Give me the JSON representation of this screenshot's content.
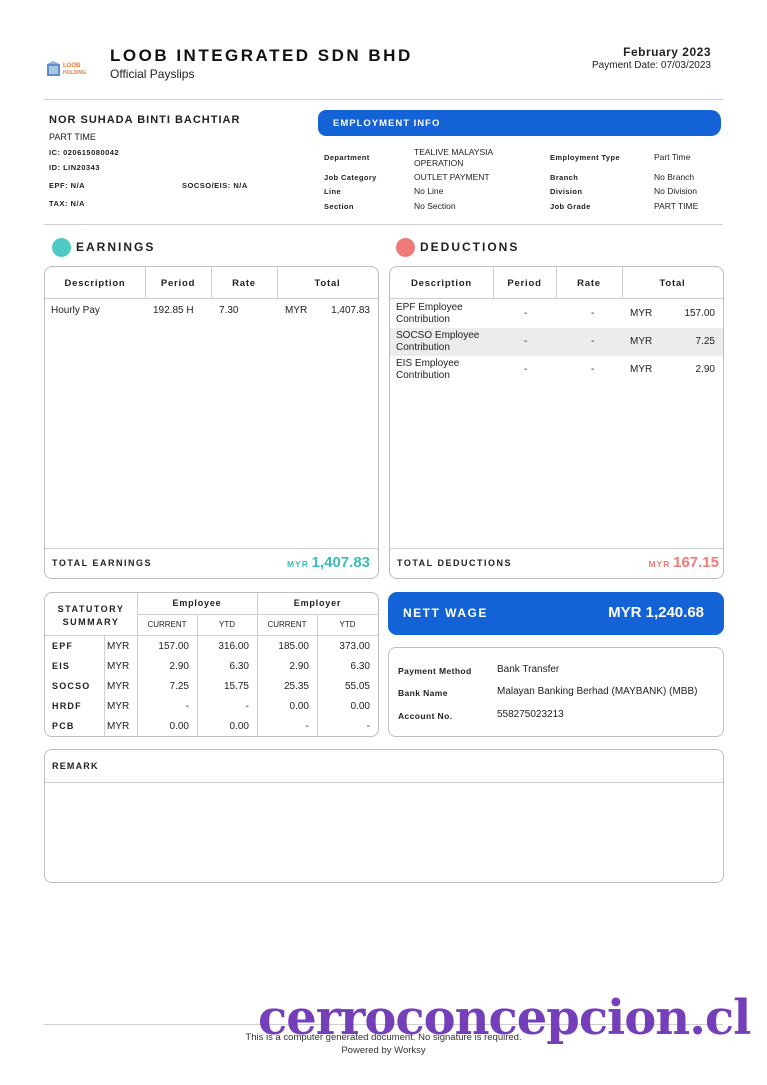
{
  "header": {
    "company_name": "LOOB INTEGRATED SDN BHD",
    "document_title": "Official Payslips",
    "period": "February 2023",
    "payment_date": "Payment Date: 07/03/2023",
    "logo_text_top": "LOOB",
    "logo_text_bottom": "HOLDING"
  },
  "employee": {
    "name": "NOR SUHADA BINTI BACHTIAR",
    "type": "PART TIME",
    "ic": "IC: 020615080042",
    "id": "ID: LIN20343",
    "epf": "EPF: N/A",
    "socso_eis": "SOCSO/EIS: N/A",
    "tax": "TAX: N/A"
  },
  "employment_info": {
    "title": "EMPLOYMENT INFO",
    "department_label": "Department",
    "department_value_1": "TEALIVE MALAYSIA",
    "department_value_2": "OPERATION",
    "job_category_label": "Job Category",
    "job_category_value": "OUTLET PAYMENT",
    "line_label": "Line",
    "line_value": "No Line",
    "section_label": "Section",
    "section_value": "No Section",
    "employment_type_label": "Employment Type",
    "employment_type_value": "Part Time",
    "branch_label": "Branch",
    "branch_value": "No Branch",
    "division_label": "Division",
    "division_value": "No Division",
    "job_grade_label": "Job Grade",
    "job_grade_value": "PART TIME"
  },
  "earnings": {
    "title": "EARNINGS",
    "color": "#4fc9c3",
    "columns": [
      "Description",
      "Period",
      "Rate",
      "Total"
    ],
    "rows": [
      {
        "description": "Hourly Pay",
        "period": "192.85 H",
        "rate": "7.30",
        "currency": "MYR",
        "total": "1,407.83"
      }
    ],
    "total_label": "TOTAL EARNINGS",
    "total_currency": "MYR",
    "total_value": "1,407.83"
  },
  "deductions": {
    "title": "DEDUCTIONS",
    "color": "#f07a7a",
    "columns": [
      "Description",
      "Period",
      "Rate",
      "Total"
    ],
    "rows": [
      {
        "description_1": "EPF Employee",
        "description_2": "Contribution",
        "period": "-",
        "rate": "-",
        "currency": "MYR",
        "total": "157.00"
      },
      {
        "description_1": "SOCSO Employee",
        "description_2": "Contribution",
        "period": "-",
        "rate": "-",
        "currency": "MYR",
        "total": "7.25"
      },
      {
        "description_1": "EIS Employee",
        "description_2": "Contribution",
        "period": "-",
        "rate": "-",
        "currency": "MYR",
        "total": "2.90"
      }
    ],
    "total_label": "TOTAL DEDUCTIONS",
    "total_currency": "MYR",
    "total_value": "167.15"
  },
  "statutory": {
    "title_1": "STATUTORY",
    "title_2": "SUMMARY",
    "employee_label": "Employee",
    "employer_label": "Employer",
    "current_label": "CURRENT",
    "ytd_label": "YTD",
    "rows": [
      {
        "name": "EPF",
        "currency": "MYR",
        "emp_current": "157.00",
        "emp_ytd": "316.00",
        "er_current": "185.00",
        "er_ytd": "373.00"
      },
      {
        "name": "EIS",
        "currency": "MYR",
        "emp_current": "2.90",
        "emp_ytd": "6.30",
        "er_current": "2.90",
        "er_ytd": "6.30"
      },
      {
        "name": "SOCSO",
        "currency": "MYR",
        "emp_current": "7.25",
        "emp_ytd": "15.75",
        "er_current": "25.35",
        "er_ytd": "55.05"
      },
      {
        "name": "HRDF",
        "currency": "MYR",
        "emp_current": "-",
        "emp_ytd": "-",
        "er_current": "0.00",
        "er_ytd": "0.00"
      },
      {
        "name": "PCB",
        "currency": "MYR",
        "emp_current": "0.00",
        "emp_ytd": "0.00",
        "er_current": "-",
        "er_ytd": "-"
      }
    ]
  },
  "nett_wage": {
    "label": "NETT WAGE",
    "value": "MYR 1,240.68"
  },
  "payment": {
    "method_label": "Payment Method",
    "method_value": "Bank Transfer",
    "bank_label": "Bank Name",
    "bank_value": "Malayan Banking Berhad (MAYBANK) (MBB)",
    "account_label": "Account No.",
    "account_value": "558275023213"
  },
  "remark": {
    "title": "REMARK"
  },
  "footer": {
    "line_1": "This is a computer generated document. No signature is required.",
    "line_2": "Powered by Worksy",
    "watermark": "cerroconcepcion.cl"
  },
  "colors": {
    "accent_blue": "#1463d6",
    "earnings_teal": "#3bbdb5",
    "deductions_red": "#f07a7a"
  }
}
